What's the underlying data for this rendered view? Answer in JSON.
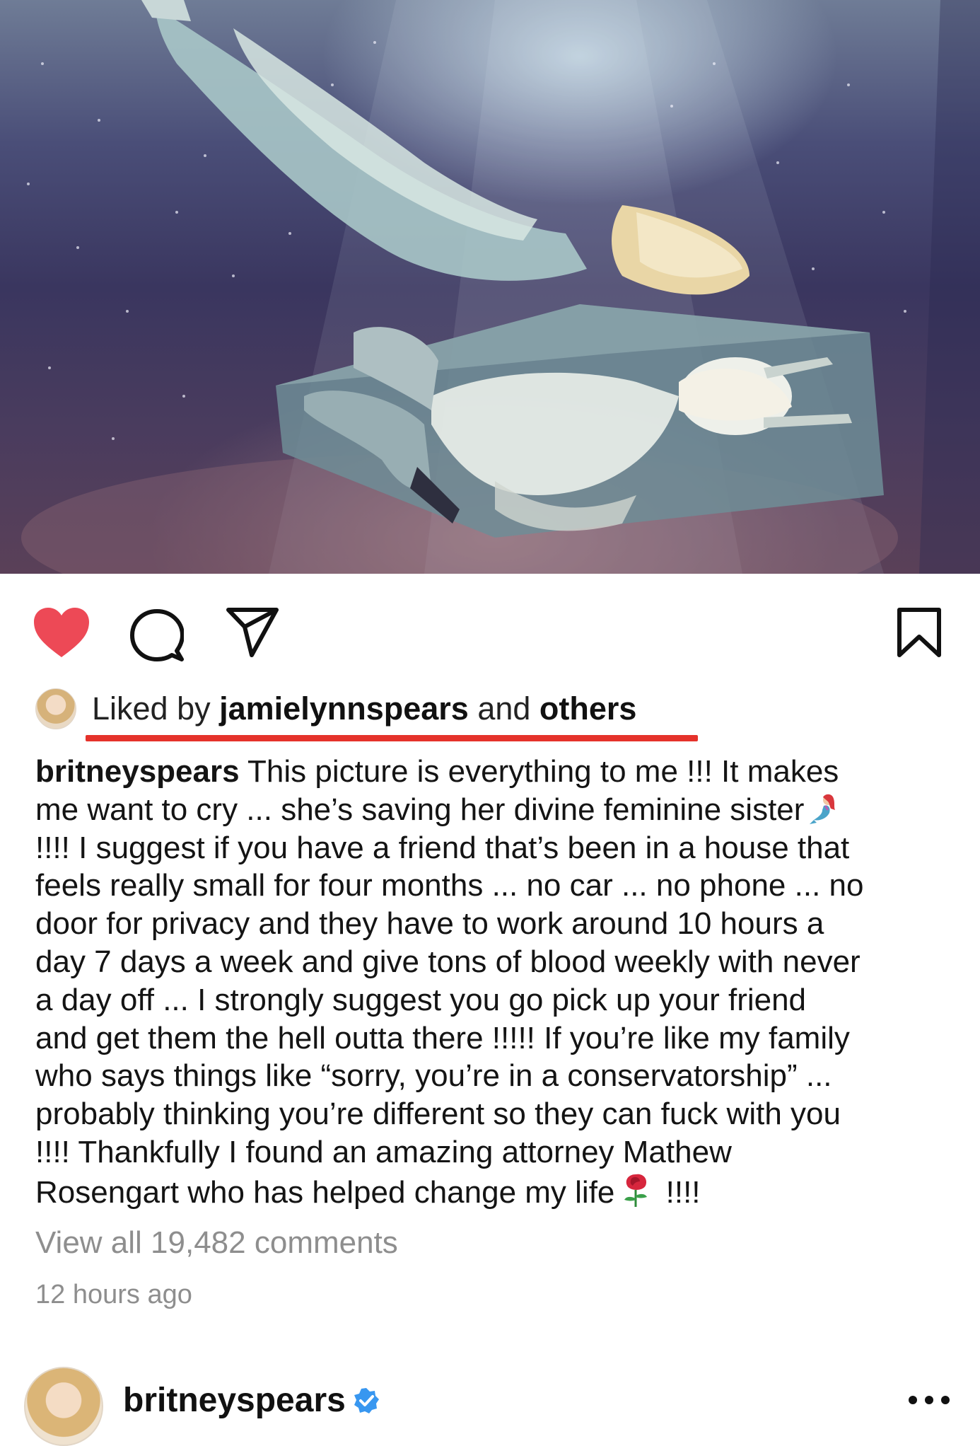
{
  "post": {
    "likes": {
      "prefix": "Liked by ",
      "user": "jamielynnspears",
      "middle": " and ",
      "others": "others"
    },
    "caption": {
      "username": "britneyspears",
      "lines": [
        " This picture is everything to me !!! It makes",
        "me want to cry ... she’s saving her divine feminine sister",
        "!!!! I suggest if you have a friend that’s been in a house that",
        "feels really small for four months ... no car ... no phone ... no",
        "door for privacy  and they have to work around 10 hours a",
        "day 7 days a week and give tons of blood weekly with never",
        "a day off ... I strongly suggest you go pick up your friend",
        "and get them the hell outta there !!!!! If you’re like my family",
        "who says things like “sorry, you’re in a conservatorship” ...",
        "probably thinking you’re different so they can fuck with you",
        "!!!! Thankfully I found an amazing attorney Mathew",
        "Rosengart who has helped change my life",
        " !!!!"
      ]
    },
    "view_comments": "View all 19,482 comments",
    "timestamp": "12 hours ago",
    "icons": {
      "like": "heart-filled-icon",
      "comment": "comment-bubble-icon",
      "share": "paper-plane-icon",
      "save": "bookmark-icon",
      "emoji_1": "mermaid-emoji",
      "emoji_2": "rose-emoji"
    },
    "colors": {
      "like": "#ed4956",
      "underline": "#e5322b",
      "muted_text": "#8e8e8e",
      "verified": "#3897f0"
    }
  },
  "next_post": {
    "username": "britneyspears",
    "icons": {
      "verified": "verified-badge-icon",
      "more": "more-options-icon"
    }
  }
}
